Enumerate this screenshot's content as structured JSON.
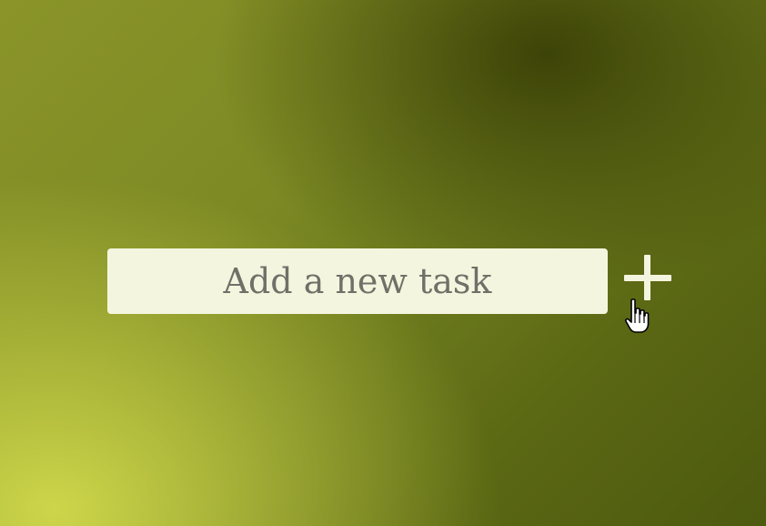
{
  "task_form": {
    "input_value": "",
    "input_placeholder": "Add a new task",
    "add_button_icon": "plus-icon"
  },
  "pointer": {
    "icon": "hand-pointer-icon"
  },
  "colors": {
    "input_background": "#f4f5df",
    "placeholder_text": "#707068",
    "plus_icon": "#f4f5df",
    "background_dark": "#4d5a0f",
    "background_light": "#cdd64a"
  }
}
